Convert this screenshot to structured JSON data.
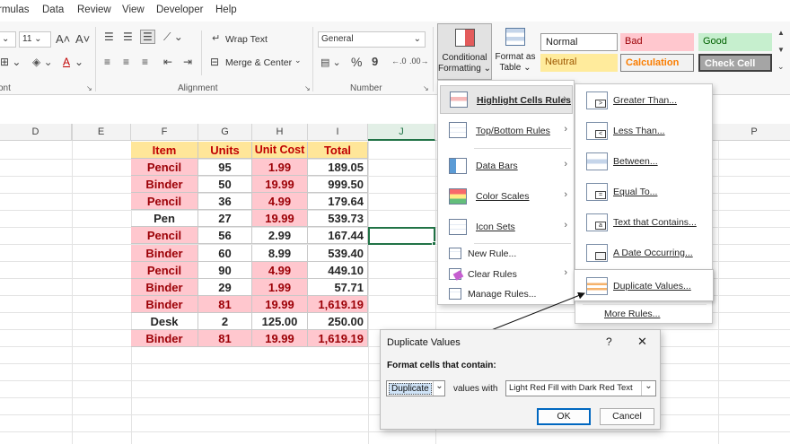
{
  "menu": {
    "tabs": [
      "rmulas",
      "Data",
      "Review",
      "View",
      "Developer",
      "Help"
    ]
  },
  "ribbon": {
    "font_size": "11",
    "font_increase": "A˄",
    "font_decrease": "A˅",
    "wrap_text": "Wrap Text",
    "merge_center": "Merge & Center",
    "number_format": "General",
    "percent": "%",
    "comma": "9",
    "groups": {
      "font": "ont",
      "alignment": "Alignment",
      "number": "Number"
    },
    "cf_button": [
      "Conditional",
      "Formatting"
    ],
    "format_table": [
      "Format as",
      "Table"
    ],
    "styles": {
      "normal": "Normal",
      "bad": "Bad",
      "good": "Good",
      "neutral": "Neutral",
      "calculation": "Calculation",
      "check_cell": "Check Cell"
    }
  },
  "columns": [
    "D",
    "E",
    "F",
    "G",
    "H",
    "I",
    "J",
    "P"
  ],
  "table": {
    "headers": [
      "Item",
      "Units",
      "Unit Cost",
      "Total"
    ],
    "rows": [
      {
        "item": "Pencil",
        "units": "95",
        "cost": "1.99",
        "total": "189.05",
        "dup_item": true,
        "dup_units": false,
        "dup_cost": true,
        "dup_total": false
      },
      {
        "item": "Binder",
        "units": "50",
        "cost": "19.99",
        "total": "999.50",
        "dup_item": true,
        "dup_units": false,
        "dup_cost": true,
        "dup_total": false
      },
      {
        "item": "Pencil",
        "units": "36",
        "cost": "4.99",
        "total": "179.64",
        "dup_item": true,
        "dup_units": false,
        "dup_cost": true,
        "dup_total": false
      },
      {
        "item": "Pen",
        "units": "27",
        "cost": "19.99",
        "total": "539.73",
        "dup_item": false,
        "dup_units": false,
        "dup_cost": true,
        "dup_total": false
      },
      {
        "item": "Pencil",
        "units": "56",
        "cost": "2.99",
        "total": "167.44",
        "dup_item": true,
        "dup_units": false,
        "dup_cost": false,
        "dup_total": false
      },
      {
        "item": "Binder",
        "units": "60",
        "cost": "8.99",
        "total": "539.40",
        "dup_item": true,
        "dup_units": false,
        "dup_cost": false,
        "dup_total": false
      },
      {
        "item": "Pencil",
        "units": "90",
        "cost": "4.99",
        "total": "449.10",
        "dup_item": true,
        "dup_units": false,
        "dup_cost": true,
        "dup_total": false
      },
      {
        "item": "Binder",
        "units": "29",
        "cost": "1.99",
        "total": "57.71",
        "dup_item": true,
        "dup_units": false,
        "dup_cost": true,
        "dup_total": false
      },
      {
        "item": "Binder",
        "units": "81",
        "cost": "19.99",
        "total": "1,619.19",
        "dup_item": true,
        "dup_units": true,
        "dup_cost": true,
        "dup_total": true
      },
      {
        "item": "Desk",
        "units": "2",
        "cost": "125.00",
        "total": "250.00",
        "dup_item": false,
        "dup_units": false,
        "dup_cost": false,
        "dup_total": false
      },
      {
        "item": "Binder",
        "units": "81",
        "cost": "19.99",
        "total": "1,619.19",
        "dup_item": true,
        "dup_units": true,
        "dup_cost": true,
        "dup_total": true
      }
    ]
  },
  "cf_menu": {
    "highlight_cells_rules": "Highlight Cells Rules",
    "top_bottom_rules": "Top/Bottom Rules",
    "data_bars": "Data Bars",
    "color_scales": "Color Scales",
    "icon_sets": "Icon Sets",
    "new_rule": "New Rule...",
    "clear_rules": "Clear Rules",
    "manage_rules": "Manage Rules..."
  },
  "cf_submenu": {
    "greater_than": "Greater Than...",
    "less_than": "Less Than...",
    "between": "Between...",
    "equal_to": "Equal To...",
    "text_contains": "Text that Contains...",
    "date_occurring": "A Date Occurring...",
    "duplicate_values": "Duplicate Values...",
    "more_rules": "More Rules..."
  },
  "dialog": {
    "title": "Duplicate Values",
    "help": "?",
    "close": "✕",
    "prompt": "Format cells that contain:",
    "type_value": "Duplicate",
    "values_with": "values with",
    "format_value": "Light Red Fill with Dark Red Text",
    "ok": "OK",
    "cancel": "Cancel"
  },
  "colors": {
    "dup_fill": "#ffc7ce",
    "dup_text": "#9c0006",
    "header_fill": "#ffe699",
    "header_text": "#c00000",
    "selection": "#217346"
  }
}
